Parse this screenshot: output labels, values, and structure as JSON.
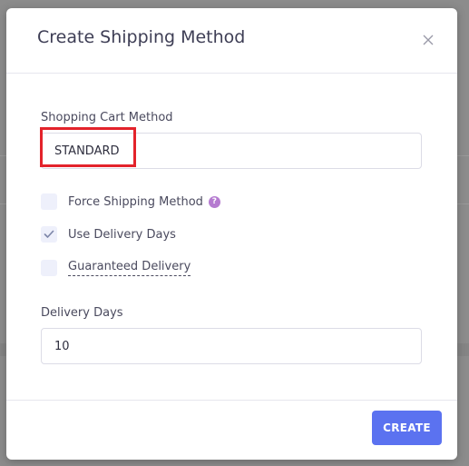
{
  "modal": {
    "title": "Create Shipping Method",
    "close_icon": "close-icon"
  },
  "form": {
    "cart_method": {
      "label": "Shopping Cart Method",
      "value": "STANDARD"
    },
    "checkboxes": [
      {
        "label": "Force Shipping Method",
        "checked": false,
        "help_icon": "question-icon"
      },
      {
        "label": "Use Delivery Days",
        "checked": true
      },
      {
        "label": "Guaranteed Delivery",
        "checked": false
      }
    ],
    "delivery_days": {
      "label": "Delivery Days",
      "value": "10"
    }
  },
  "footer": {
    "create_label": "CREATE"
  },
  "help_glyph": "?",
  "colors": {
    "accent": "#5b72f0",
    "highlight": "#e3232b",
    "help_icon": "#b57bd0",
    "checkbox_bg": "#eef0fb"
  }
}
